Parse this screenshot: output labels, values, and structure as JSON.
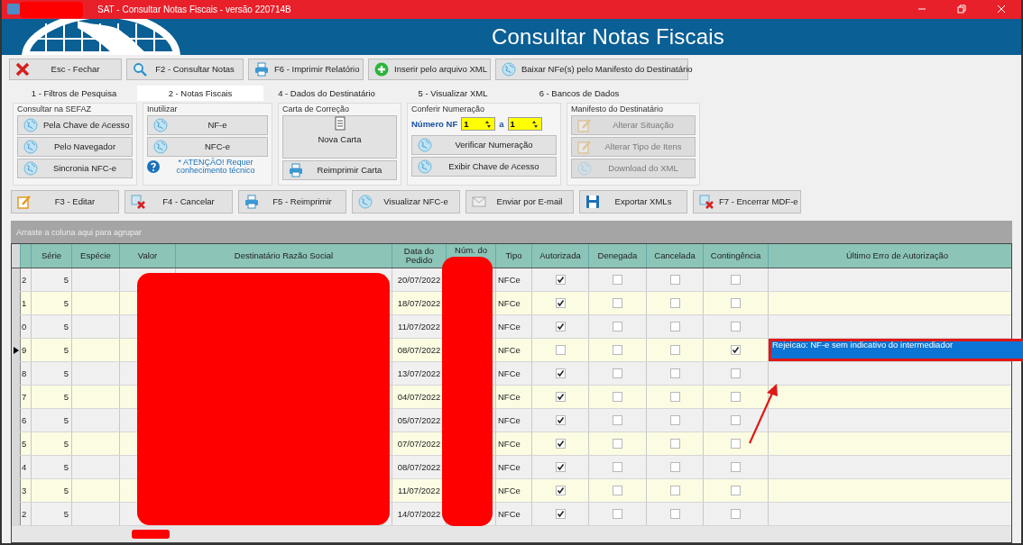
{
  "window": {
    "title": "SAT - Consultar Notas Fiscais - versão 220714B"
  },
  "header": {
    "title": "Consultar Notas Fiscais"
  },
  "toolbar": [
    {
      "label": "Esc - Fechar"
    },
    {
      "label": "F2 - Consultar Notas"
    },
    {
      "label": "F6 - Imprimir Relatório"
    },
    {
      "label": "Inserir pelo arquivo XML"
    },
    {
      "label": "Baixar NFe(s) pelo Manifesto do Destinatário"
    }
  ],
  "tabs": [
    {
      "label": "1 - Filtros de Pesquisa",
      "selected": false
    },
    {
      "label": "2 - Notas Fiscais",
      "selected": true
    },
    {
      "label": "4 - Dados do Destinatário",
      "selected": false
    },
    {
      "label": "5 - Visualizar XML",
      "selected": false
    },
    {
      "label": "6 - Bancos de Dados",
      "selected": false
    }
  ],
  "groups": [
    {
      "title": "Consultar na SEFAZ",
      "kind": "buttons",
      "buttons": [
        {
          "label": "Pela Chave de Acesso",
          "disabled": false
        },
        {
          "label": "Pelo Navegador",
          "disabled": false
        },
        {
          "label": "Sincronia NFC-e",
          "disabled": false
        }
      ]
    },
    {
      "title": "Inutilizar",
      "kind": "buttons",
      "buttons": [
        {
          "label": "NF-e",
          "disabled": false
        },
        {
          "label": "NFC-e",
          "disabled": false
        }
      ],
      "note": "* ATENÇÃO! Requer conhecimento técnico"
    },
    {
      "title": "Carta de Correção",
      "kind": "carta",
      "buttons": [
        {
          "label": "Nova Carta",
          "disabled": false
        },
        {
          "label": "Reimprimir Carta",
          "disabled": false
        }
      ]
    },
    {
      "title": "Conferir Numeração",
      "kind": "range",
      "range": {
        "label": "Número NF",
        "from": "1",
        "separator": "a",
        "to": "1"
      },
      "buttons": [
        {
          "label": "Verificar Numeração",
          "disabled": false
        },
        {
          "label": "Exibir Chave de Acesso",
          "disabled": false
        }
      ]
    },
    {
      "title": "Manifesto do Destinatário",
      "kind": "buttons",
      "buttons": [
        {
          "label": "Alterar Situação",
          "disabled": true
        },
        {
          "label": "Alterar Tipo de Itens",
          "disabled": true
        },
        {
          "label": "Download do XML",
          "disabled": true
        }
      ]
    }
  ],
  "actions": [
    {
      "label": "F3 - Editar"
    },
    {
      "label": "F4 - Cancelar"
    },
    {
      "label": "F5 - Reimprimir"
    },
    {
      "label": "Visualizar NFC-e"
    },
    {
      "label": "Enviar por E-mail"
    },
    {
      "label": "Exportar XMLs"
    },
    {
      "label": "F7 - Encerrar MDF-e"
    }
  ],
  "group_panel": {
    "hint": "Arraste a coluna aqui para agrupar"
  },
  "table": {
    "columns": [
      "Série",
      "Espécie",
      "Valor",
      "Destinatário Razão Social",
      "Data do Pedido",
      "Núm. do",
      "Tipo",
      "Autorizada",
      "Denegada",
      "Cancelada",
      "Contingência",
      "Último Erro de Autorização"
    ],
    "rows": [
      {
        "column_1": "2",
        "serie": "5",
        "data": "20/07/2022",
        "tipo": "NFCe",
        "autorizada": true,
        "denegada": false,
        "cancelada": false,
        "contingencia": false,
        "selected": false
      },
      {
        "column_1": "1",
        "serie": "5",
        "data": "18/07/2022",
        "tipo": "NFCe",
        "autorizada": true,
        "denegada": false,
        "cancelada": false,
        "contingencia": false,
        "selected": false
      },
      {
        "column_1": "0",
        "serie": "5",
        "data": "11/07/2022",
        "tipo": "NFCe",
        "autorizada": true,
        "denegada": false,
        "cancelada": false,
        "contingencia": false,
        "selected": false
      },
      {
        "column_1": "9",
        "serie": "5",
        "data": "08/07/2022",
        "tipo": "NFCe",
        "autorizada": false,
        "denegada": false,
        "cancelada": false,
        "contingencia": true,
        "erro": "Rejeicao: NF-e sem indicativo do intermediador",
        "selected": true
      },
      {
        "column_1": "8",
        "serie": "5",
        "data": "13/07/2022",
        "tipo": "NFCe",
        "autorizada": true,
        "denegada": false,
        "cancelada": false,
        "contingencia": false,
        "selected": false
      },
      {
        "column_1": "7",
        "serie": "5",
        "data": "04/07/2022",
        "tipo": "NFCe",
        "autorizada": true,
        "denegada": false,
        "cancelada": false,
        "contingencia": false,
        "selected": false
      },
      {
        "column_1": "6",
        "serie": "5",
        "data": "05/07/2022",
        "tipo": "NFCe",
        "autorizada": true,
        "denegada": false,
        "cancelada": false,
        "contingencia": false,
        "selected": false
      },
      {
        "column_1": "5",
        "serie": "5",
        "data": "07/07/2022",
        "tipo": "NFCe",
        "autorizada": true,
        "denegada": false,
        "cancelada": false,
        "contingencia": false,
        "selected": false
      },
      {
        "column_1": "4",
        "serie": "5",
        "data": "08/07/2022",
        "tipo": "NFCe",
        "autorizada": true,
        "denegada": false,
        "cancelada": false,
        "contingencia": false,
        "selected": false
      },
      {
        "column_1": "3",
        "serie": "5",
        "data": "11/07/2022",
        "tipo": "NFCe",
        "autorizada": true,
        "denegada": false,
        "cancelada": false,
        "contingencia": false,
        "selected": false
      },
      {
        "column_1": "2",
        "serie": "5",
        "data": "14/07/2022",
        "tipo": "NFCe",
        "autorizada": true,
        "denegada": false,
        "cancelada": false,
        "contingencia": false,
        "selected": false
      }
    ]
  }
}
